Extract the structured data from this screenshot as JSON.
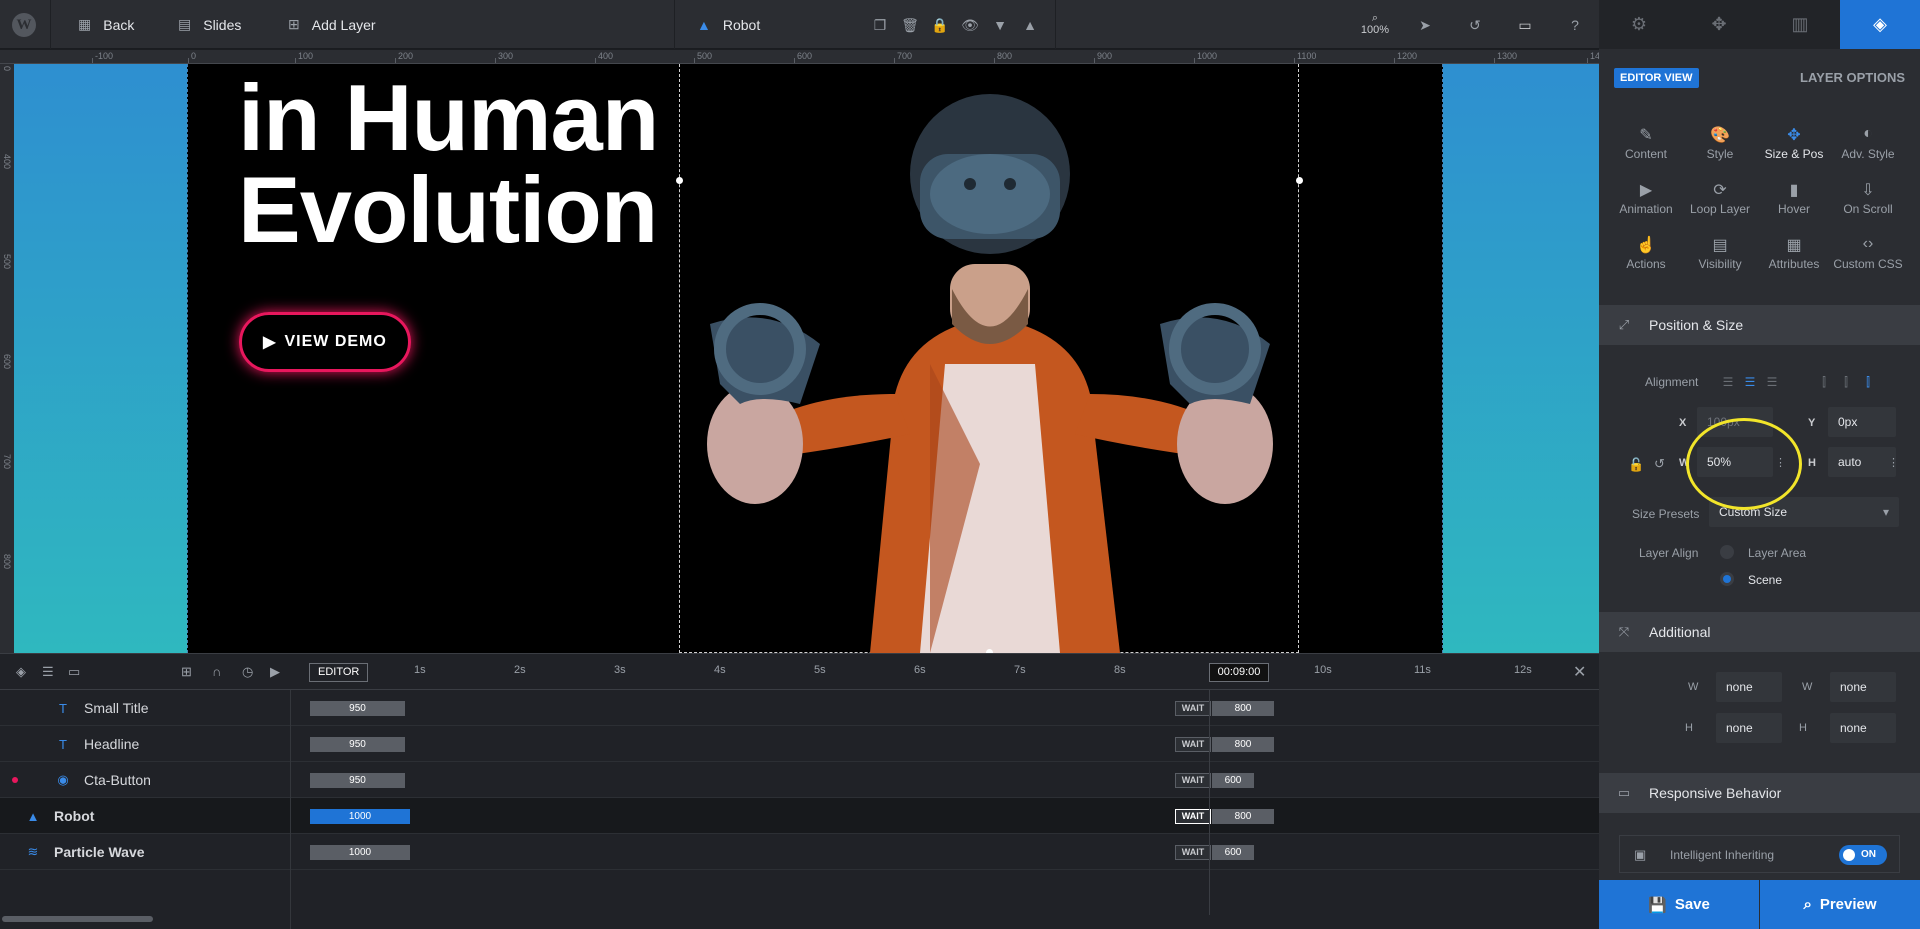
{
  "topbar": {
    "back_label": "Back",
    "slides_label": "Slides",
    "add_layer_label": "Add Layer",
    "layer_name": "Robot",
    "zoom": "100%"
  },
  "ruler": {
    "h_ticks": [
      "-100",
      "0",
      "100",
      "200",
      "300",
      "400",
      "500",
      "600",
      "700",
      "800",
      "900",
      "1000",
      "1100",
      "1200",
      "1300",
      "14"
    ],
    "v_ticks": [
      "0",
      "400",
      "500",
      "600",
      "700",
      "800"
    ]
  },
  "slide": {
    "headline_line1": "in Human",
    "headline_line2": "Evolution",
    "cta_label": "VIEW DEMO",
    "robot_figure": "person with VR headset and controllers"
  },
  "timeline": {
    "editor_tag": "EDITOR",
    "time": "00:09:00",
    "seconds": [
      "1s",
      "2s",
      "3s",
      "4s",
      "5s",
      "6s",
      "7s",
      "8s",
      "10s",
      "11s",
      "12s"
    ],
    "wait_label": "WAIT",
    "rows": [
      {
        "name": "Small Title",
        "in": "950",
        "out": "800"
      },
      {
        "name": "Headline",
        "in": "950",
        "out": "800"
      },
      {
        "name": "Cta-Button",
        "in": "950",
        "out": "600"
      },
      {
        "name": "Robot",
        "in": "1000",
        "out": "800"
      },
      {
        "name": "Particle Wave",
        "in": "1000",
        "out": "600"
      }
    ]
  },
  "panel": {
    "editor_view": "EDITOR VIEW",
    "layer_options": "LAYER OPTIONS",
    "options": [
      {
        "label": "Content",
        "icon": "pencil-icon"
      },
      {
        "label": "Style",
        "icon": "palette-icon"
      },
      {
        "label": "Size & Pos",
        "icon": "size-pos-icon"
      },
      {
        "label": "Adv. Style",
        "icon": "drop-icon"
      },
      {
        "label": "Animation",
        "icon": "play-icon"
      },
      {
        "label": "Loop Layer",
        "icon": "loop-icon"
      },
      {
        "label": "Hover",
        "icon": "mouse-icon"
      },
      {
        "label": "On Scroll",
        "icon": "scroll-icon"
      },
      {
        "label": "Actions",
        "icon": "hand-icon"
      },
      {
        "label": "Visibility",
        "icon": "document-icon"
      },
      {
        "label": "Attributes",
        "icon": "attributes-icon"
      },
      {
        "label": "Custom CSS",
        "icon": "code-icon"
      }
    ],
    "position_size": {
      "title": "Position & Size",
      "alignment_label": "Alignment",
      "x_label": "X",
      "x_value": "100px",
      "y_label": "Y",
      "y_value": "0px",
      "w_label": "W",
      "w_value": "50%",
      "h_label": "H",
      "h_value": "auto",
      "size_presets_label": "Size Presets",
      "size_presets_value": "Custom Size",
      "layer_align_label": "Layer Align",
      "layer_area_label": "Layer Area",
      "scene_label": "Scene"
    },
    "additional": {
      "title": "Additional",
      "min_w": "none",
      "max_w": "none",
      "min_h": "none",
      "max_h": "none"
    },
    "responsive": {
      "title": "Responsive Behavior",
      "intelligent_inheriting": "Intelligent Inheriting",
      "toggle": "ON"
    },
    "save_label": "Save",
    "preview_label": "Preview"
  },
  "colors": {
    "accent": "#1f74d6",
    "cta_border": "#e8175d",
    "highlight": "#f2e52a"
  }
}
